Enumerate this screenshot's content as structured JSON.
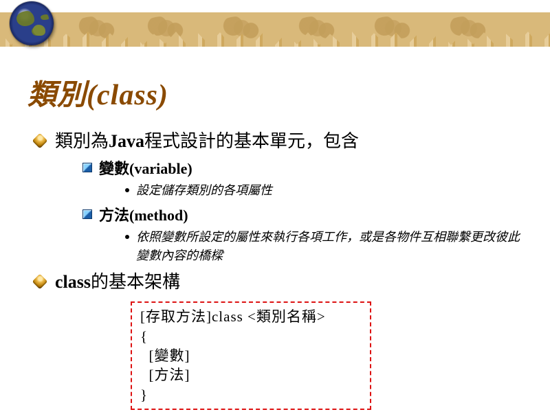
{
  "title": {
    "cjk": "類別",
    "lat": "(class)"
  },
  "bullets1": [
    {
      "pre": "類別為",
      "lat": "Java",
      "post": "程式設計的基本單元，包含",
      "children": [
        {
          "cjk": "變數",
          "lat": "(variable)",
          "sub": [
            "設定儲存類別的各項屬性"
          ]
        },
        {
          "cjk": "方法",
          "lat": "(method)",
          "sub": [
            "依照變數所設定的屬性來執行各項工作，或是各物件互相聯繫更改彼此變數內容的橋樑"
          ]
        }
      ]
    },
    {
      "lat": "class",
      "post": "的基本架構"
    }
  ],
  "codebox": "[存取方法]class <類別名稱>\n{\n  [變數]\n  [方法]\n}",
  "icons": {
    "globe": "globe-icon",
    "diamond": "diamond-bullet-icon",
    "square": "square-bullet-icon",
    "dot": "dot-bullet-icon"
  }
}
